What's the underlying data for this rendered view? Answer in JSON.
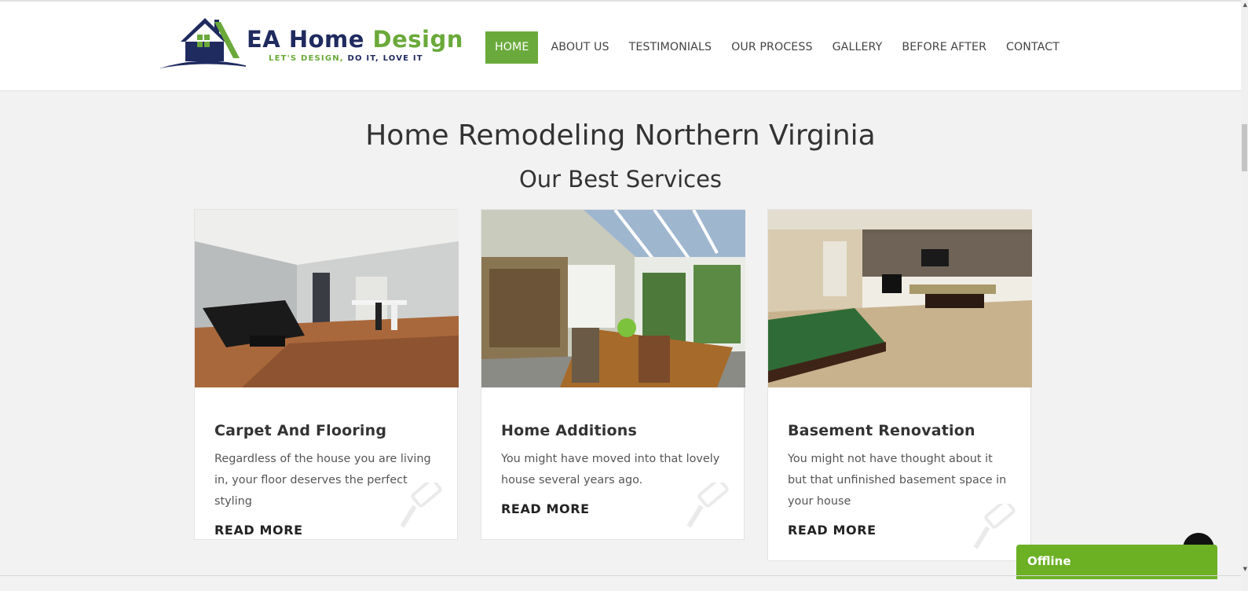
{
  "brand": {
    "name_part1": "EA Home ",
    "name_part2": "Design",
    "tagline_part1": "LET'S DESIGN, ",
    "tagline_part2": "DO IT, LOVE IT",
    "colors": {
      "navy": "#1f2a5f",
      "green": "#6aa93a"
    }
  },
  "nav": {
    "items": [
      "HOME",
      "ABOUT US",
      "TESTIMONIALS",
      "OUR PROCESS",
      "GALLERY",
      "BEFORE AFTER",
      "CONTACT"
    ],
    "active": "HOME",
    "active_color": "#6aaa3c"
  },
  "main": {
    "title": "Home Remodeling Northern Virginia",
    "subtitle": "Our Best Services"
  },
  "services": [
    {
      "title": "Carpet And Flooring",
      "text": "Regardless of the house you are living in, your floor deserves the perfect styling",
      "link": "READ MORE",
      "image_icon": "living-room-piano-photo"
    },
    {
      "title": "Home Additions",
      "text": "You might have moved into that lovely house several years ago.",
      "link": "READ MORE",
      "image_icon": "sunroom-dining-photo"
    },
    {
      "title": "Basement Renovation",
      "text": "You might not have thought about it but that unfinished basement space in your house",
      "link": "READ MORE",
      "image_icon": "basement-billiards-photo"
    }
  ],
  "chat": {
    "status": "Offline",
    "color": "#6cb024"
  },
  "icons": {
    "scroll_to_top": "chevron-up-icon",
    "card_watermark": "paint-roller-icon"
  }
}
